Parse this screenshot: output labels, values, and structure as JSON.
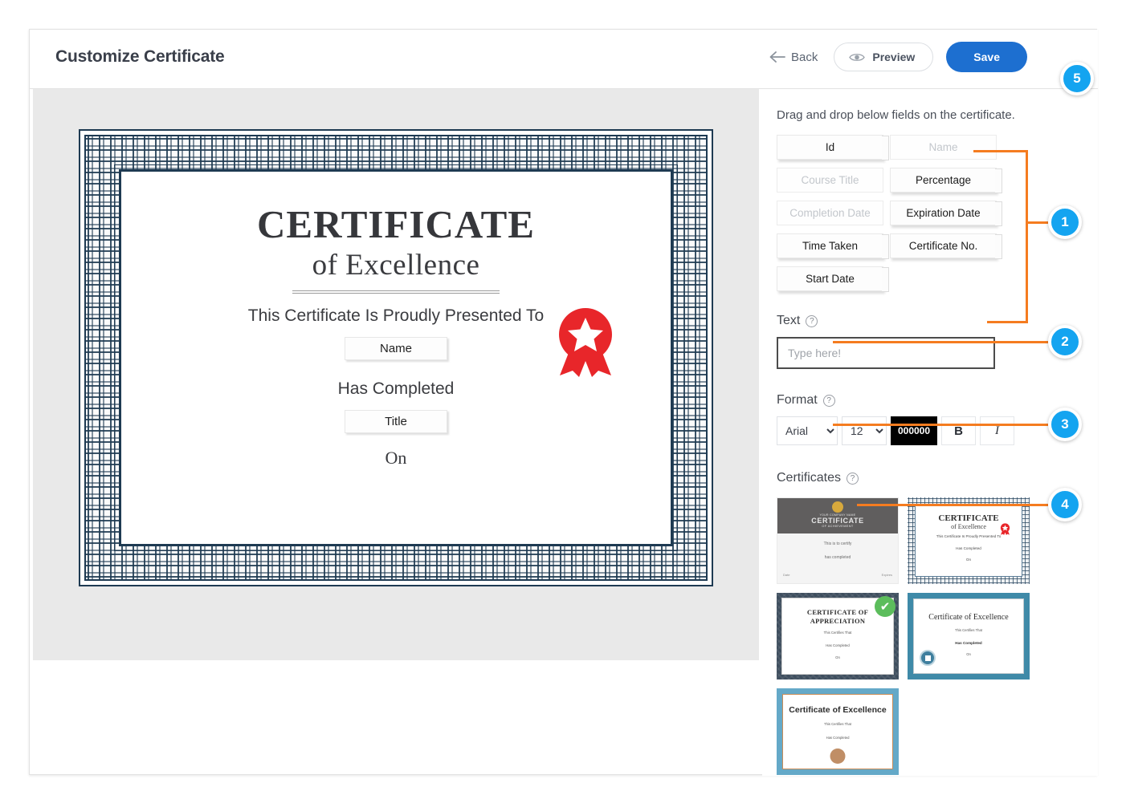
{
  "header": {
    "title": "Customize Certificate",
    "back_label": "Back",
    "preview_label": "Preview",
    "save_label": "Save"
  },
  "steps": {
    "one": "1",
    "two": "2",
    "three": "3",
    "four": "4",
    "five": "5"
  },
  "panel": {
    "hint": "Drag and drop below fields on the certificate.",
    "fields": [
      {
        "label": "Id",
        "state": "enabled"
      },
      {
        "label": "Name",
        "state": "disabled"
      },
      {
        "label": "Course Title",
        "state": "disabled"
      },
      {
        "label": "Percentage",
        "state": "enabled"
      },
      {
        "label": "Completion Date",
        "state": "disabled"
      },
      {
        "label": "Expiration Date",
        "state": "enabled"
      },
      {
        "label": "Time Taken",
        "state": "enabled"
      },
      {
        "label": "Certificate No.",
        "state": "enabled"
      },
      {
        "label": "Start Date",
        "state": "enabled"
      }
    ],
    "text": {
      "label": "Text",
      "help": "?",
      "value": "",
      "placeholder": "Type here!"
    },
    "format": {
      "label": "Format",
      "help": "?",
      "font_family": "Arial",
      "font_family_options": [
        "Arial"
      ],
      "font_size": "12",
      "font_size_options": [
        "12"
      ],
      "color": "000000",
      "bold_label": "B",
      "italic_label": "I"
    },
    "certificates": {
      "label": "Certificates",
      "help": "?",
      "selected_index": 2,
      "check_glyph": "✔",
      "items": [
        {
          "name": "achievement-grey",
          "company": "YOUR COMPANY NAME",
          "title": "CERTIFICATE",
          "subtitle": "OF ACHIEVEMENT",
          "line1": "This is to certify",
          "line2": "has completed",
          "foot_left": "Date",
          "foot_right": "Expires"
        },
        {
          "name": "excellence-ornate",
          "title": "CERTIFICATE",
          "subtitle": "of Excellence",
          "line1": "This Certificate Is Proudly Presented To",
          "line2": "Has Completed",
          "line3": "On"
        },
        {
          "name": "appreciation-damask",
          "title": "CERTIFICATE OF APPRECIATION",
          "line1": "This Certifies That",
          "line2": "Has Completed",
          "line3": "On"
        },
        {
          "name": "excellence-teal",
          "title": "Certificate of Excellence",
          "line1": "This Certifies That",
          "line2": "Has Completed",
          "line3": "On"
        },
        {
          "name": "excellence-blue",
          "title": "Certificate of Excellence",
          "line1": "This Certifies That",
          "line2": "Has Completed"
        }
      ]
    }
  },
  "certificate_preview": {
    "title": "CERTIFICATE",
    "subtitle": "of Excellence",
    "presented_line": "This Certificate Is Proudly Presented To",
    "name_field": "Name",
    "completed_line": "Has Completed",
    "title_field": "Title",
    "on_line": "On"
  },
  "colors": {
    "accent_blue": "#1d6fd0",
    "badge_blue": "#14a4f0",
    "connector_orange": "#f57c20",
    "border_navy": "#1e3a52",
    "ribbon_red": "#e8262a",
    "check_green": "#5cbd5c",
    "canvas_grey": "#e9e9e9"
  }
}
